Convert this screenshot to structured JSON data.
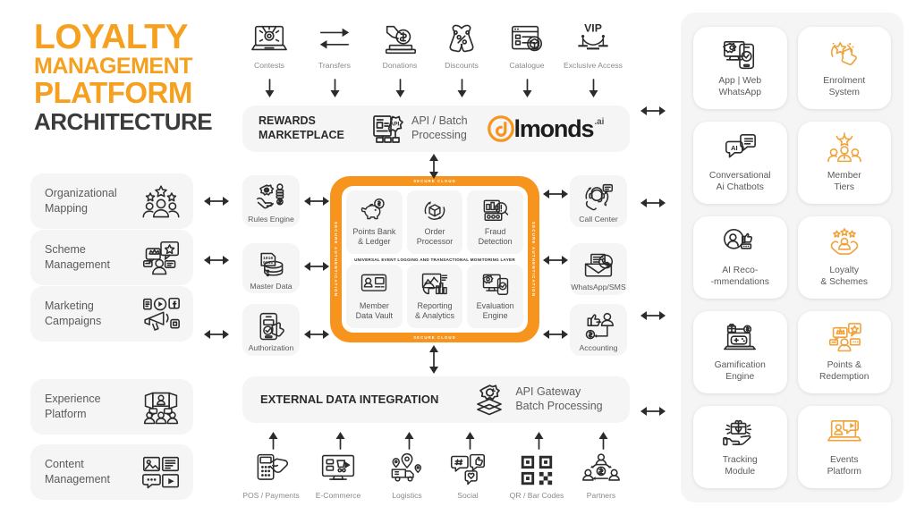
{
  "title": {
    "line1": "LOYALTY",
    "line2": "MANAGEMENT",
    "line3": "PLATFORM",
    "line4": "ARCHITECTURE",
    "accent_color": "#F5A01E",
    "dark_color": "#3b3b3b"
  },
  "left_features": [
    {
      "label": "Organizational\nMapping",
      "icon": "people-stars-icon"
    },
    {
      "label": "Scheme\nManagement",
      "icon": "chat-crown-star-icon"
    },
    {
      "label": "Marketing\nCampaigns",
      "icon": "megaphone-media-icon"
    },
    {
      "label": "Experience\nPlatform",
      "icon": "video-conference-icon"
    },
    {
      "label": "Content\nManagement",
      "icon": "media-content-icon"
    }
  ],
  "top_channels": [
    {
      "label": "Contests",
      "icon": "laptop-medal-icon"
    },
    {
      "label": "Transfers",
      "icon": "two-way-arrows-icon"
    },
    {
      "label": "Donations",
      "icon": "hand-coin-donation-icon"
    },
    {
      "label": "Discounts",
      "icon": "discount-tags-icon"
    },
    {
      "label": "Catalogue",
      "icon": "catalogue-list-icon"
    },
    {
      "label": "Exclusive Access",
      "icon": "vip-rope-icon"
    }
  ],
  "bottom_channels": [
    {
      "label": "POS / Payments",
      "icon": "pos-terminal-icon"
    },
    {
      "label": "E-Commerce",
      "icon": "desktop-cart-icon"
    },
    {
      "label": "Logistics",
      "icon": "delivery-truck-icon"
    },
    {
      "label": "Social",
      "icon": "social-hashtag-icon"
    },
    {
      "label": "QR / Bar Codes",
      "icon": "qr-code-icon"
    },
    {
      "label": "Partners",
      "icon": "partners-network-icon"
    }
  ],
  "rewards_banner": {
    "title_line1": "REWARDS",
    "title_line2": "MARKETPLACE",
    "sub_line1": "API / Batch",
    "sub_line2": "Processing",
    "icon": "api-document-icon",
    "logo_text": "lmonds",
    "logo_suffix": ".ai"
  },
  "integration_banner": {
    "title": "EXTERNAL DATA INTEGRATION",
    "sub_line1": "API Gateway",
    "sub_line2": "Batch Processing",
    "icon": "api-gateway-layers-icon"
  },
  "mid_left_tiles": [
    {
      "label": "Rules Engine",
      "icon": "gear-hand-coins-icon"
    },
    {
      "label": "Master Data",
      "icon": "database-binary-icon"
    },
    {
      "label": "Authorization",
      "icon": "mobile-approve-tap-icon"
    }
  ],
  "mid_right_tiles": [
    {
      "label": "Call Center",
      "icon": "headset-support-icon"
    },
    {
      "label": "WhatsApp/SMS",
      "icon": "envelope-chat-icon"
    },
    {
      "label": "Accounting",
      "icon": "thumbsup-user-dollar-icon"
    }
  ],
  "core": {
    "edge_top": "SECURE CLOUD",
    "edge_bottom": "SECURE CLOUD",
    "edge_left": "SECURE AUTHENTICATION",
    "edge_right": "SECURE AUTHENTICATION",
    "middle_layer": "UNIVERSAL EVENT LOGGING AND TRANSACTIONAL MONITORING LAYER",
    "accent_color": "#F7941D",
    "cells_top": [
      {
        "label": "Points Bank\n& Ledger",
        "icon": "piggy-bank-coin-icon"
      },
      {
        "label": "Order\nProcessor",
        "icon": "box-cycle-icon"
      },
      {
        "label": "Fraud\nDetection",
        "icon": "chart-magnifier-alert-icon"
      }
    ],
    "cells_bottom": [
      {
        "label": "Member\nData Vault",
        "icon": "id-card-icon"
      },
      {
        "label": "Reporting\n& Analytics",
        "icon": "analytics-chart-icon"
      },
      {
        "label": "Evaluation\nEngine",
        "icon": "screen-gear-check-icon"
      }
    ]
  },
  "right_panel": {
    "cards": [
      {
        "label": "App | Web\nWhatsApp",
        "icon": "app-web-device-icon",
        "color": "dark"
      },
      {
        "label": "Enrolment\nSystem",
        "icon": "hand-star-tap-icon",
        "color": "orange"
      },
      {
        "label": "Conversational\nAi Chatbots",
        "icon": "ai-chat-bubbles-icon",
        "color": "dark"
      },
      {
        "label": "Member\nTiers",
        "icon": "members-star-icon",
        "color": "orange"
      },
      {
        "label": "AI Reco-\n-mmendations",
        "icon": "user-thumbsup-search-icon",
        "color": "dark"
      },
      {
        "label": "Loyalty\n& Schemes",
        "icon": "hands-user-stars-icon",
        "color": "orange"
      },
      {
        "label": "Gamification\nEngine",
        "icon": "laptop-gamepad-gift-icon",
        "color": "dark"
      },
      {
        "label": "Points &\nRedemption",
        "icon": "crown-star-chat-icon",
        "color": "orange"
      },
      {
        "label": "Tracking\nModule",
        "icon": "hand-gift-heart-icon",
        "color": "dark"
      },
      {
        "label": "Events\nPlatform",
        "icon": "laptop-presenter-play-icon",
        "color": "orange"
      }
    ]
  }
}
